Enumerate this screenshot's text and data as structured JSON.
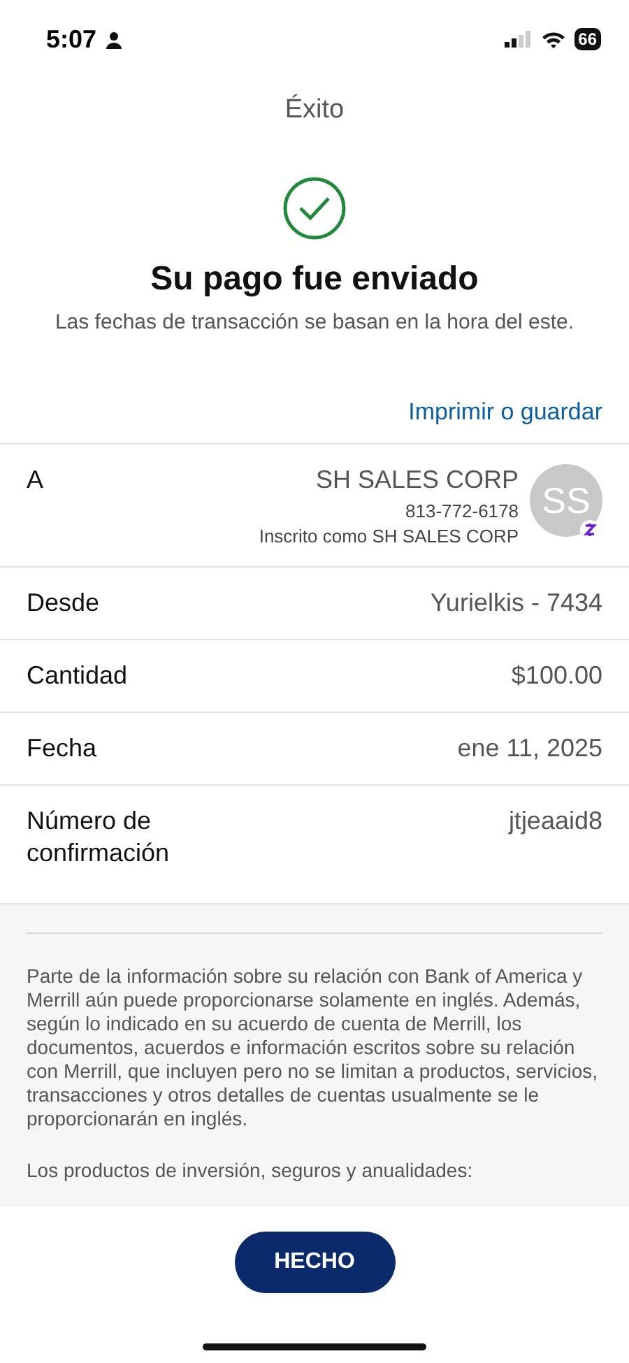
{
  "status_bar": {
    "time": "5:07",
    "battery": "66"
  },
  "header": {
    "title": "Éxito"
  },
  "confirmation": {
    "heading": "Su pago fue enviado",
    "subtitle": "Las fechas de transacción se basan en la hora del este."
  },
  "print_link": "Imprimir o guardar",
  "recipient": {
    "label": "A",
    "name": "SH SALES CORP",
    "phone": "813-772-6178",
    "enrolled_as": "Inscrito como SH SALES CORP",
    "initials": "SS"
  },
  "details": [
    {
      "label": "Desde",
      "value": "Yurielkis - 7434"
    },
    {
      "label": "Cantidad",
      "value": "$100.00"
    },
    {
      "label": "Fecha",
      "value": "ene 11, 2025"
    },
    {
      "label": "Número de confirmación",
      "value": "jtjeaaid8"
    }
  ],
  "disclosures": [
    "Parte de la información sobre su relación con Bank of America y Merrill aún puede proporcionarse solamente en inglés. Además, según lo indicado en su acuerdo de cuenta de Merrill, los documentos, acuerdos e información escritos sobre su relación con Merrill, que incluyen pero no se limitan a productos, servicios, transacciones y otros detalles de cuentas usualmente se le proporcionarán en inglés.",
    "Los productos de inversión, seguros y anualidades:"
  ],
  "done_button": "HECHO"
}
